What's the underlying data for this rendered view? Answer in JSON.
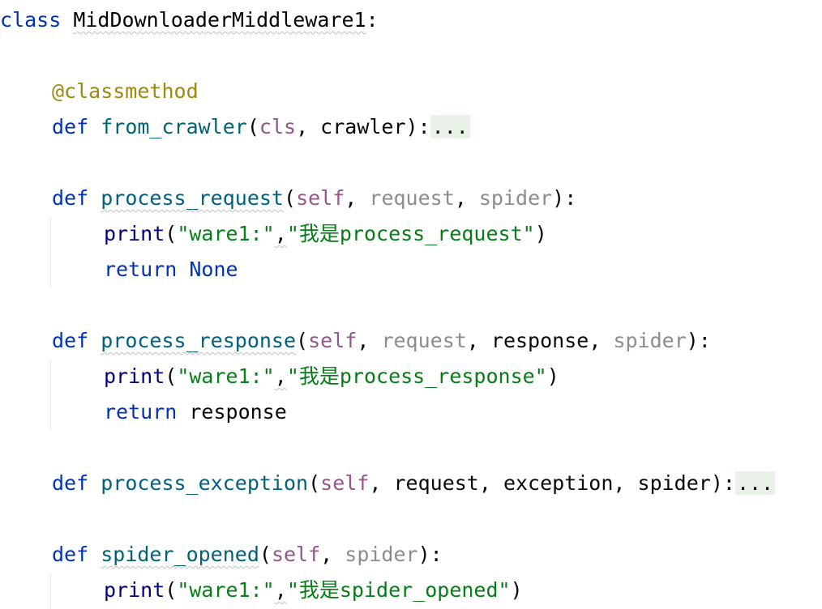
{
  "code": {
    "line1": {
      "kw": "class",
      "name": "MidDownloaderMiddleware1",
      "colon": ":"
    },
    "line3": {
      "decorator": "@classmethod"
    },
    "line4": {
      "kw": "def",
      "fn": "from_crawler",
      "open": "(",
      "p1": "cls",
      "sep1": ", ",
      "p2": "crawler",
      "close": "):",
      "fold": "..."
    },
    "line6": {
      "kw": "def",
      "fn": "process_request",
      "open": "(",
      "p1": "self",
      "sep1": ", ",
      "p2": "request",
      "sep2": ", ",
      "p3": "spider",
      "close": "):"
    },
    "line7": {
      "builtin": "print",
      "open": "(",
      "s1": "\"ware1:\"",
      "comma": ",",
      "s2": "\"我是process_request\"",
      "close": ")"
    },
    "line8": {
      "kw": "return",
      "value": "None"
    },
    "line10": {
      "kw": "def",
      "fn": "process_response",
      "open": "(",
      "p1": "self",
      "sep1": ", ",
      "p2": "request",
      "sep2": ", ",
      "p3": "response",
      "sep3": ", ",
      "p4": "spider",
      "close": "):"
    },
    "line11": {
      "builtin": "print",
      "open": "(",
      "s1": "\"ware1:\"",
      "comma": ",",
      "s2": "\"我是process_response\"",
      "close": ")"
    },
    "line12": {
      "kw": "return",
      "value": "response"
    },
    "line14": {
      "kw": "def",
      "fn": "process_exception",
      "open": "(",
      "p1": "self",
      "sep1": ", ",
      "p2": "request",
      "sep2": ", ",
      "p3": "exception",
      "sep3": ", ",
      "p4": "spider",
      "close": "):",
      "fold": "..."
    },
    "line16": {
      "kw": "def",
      "fn": "spider_opened",
      "open": "(",
      "p1": "self",
      "sep1": ", ",
      "p2": "spider",
      "close": "):"
    },
    "line17": {
      "builtin": "print",
      "open": "(",
      "s1": "\"ware1:\"",
      "comma": ",",
      "s2": "\"我是spider_opened\"",
      "close": ")"
    }
  },
  "colors": {
    "keyword": "#0033b3",
    "decorator": "#9e880d",
    "function": "#00627a",
    "self": "#94558d",
    "unused_param": "#8c8c8c",
    "string": "#067d17",
    "fold_background": "#e8f2e6"
  }
}
